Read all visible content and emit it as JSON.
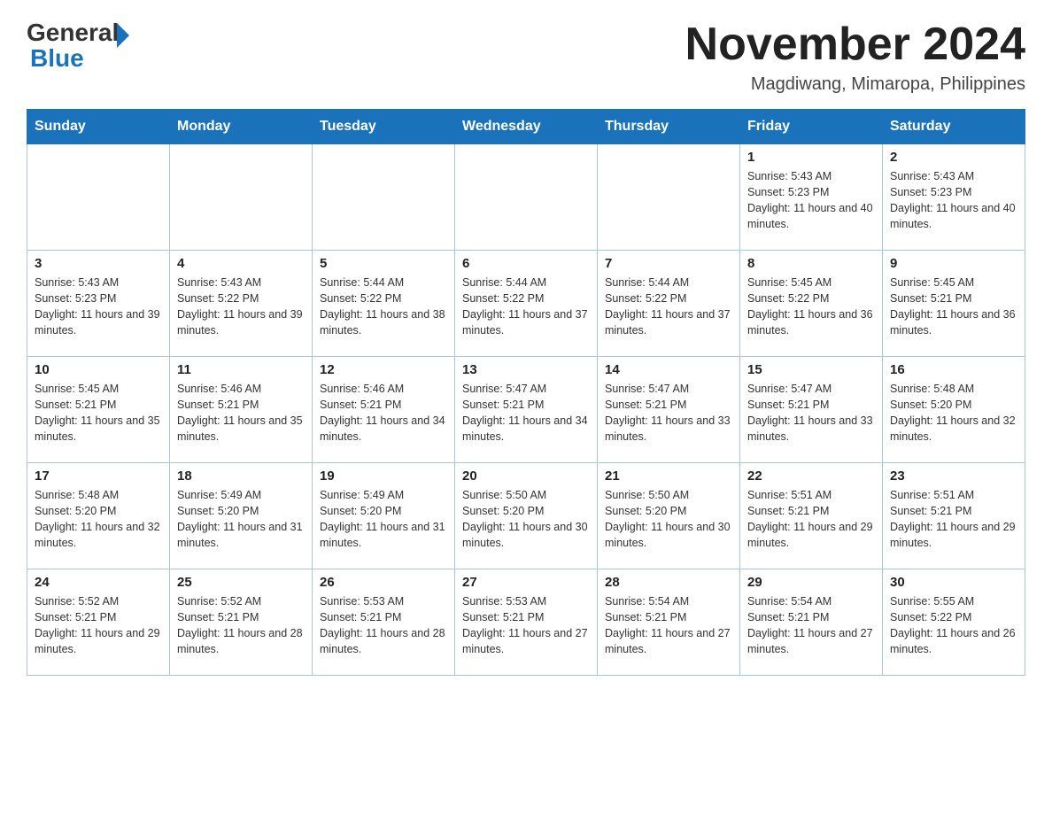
{
  "header": {
    "logo_general": "General",
    "logo_arrow": "",
    "logo_blue": "Blue",
    "main_title": "November 2024",
    "subtitle": "Magdiwang, Mimaropa, Philippines"
  },
  "days_of_week": [
    "Sunday",
    "Monday",
    "Tuesday",
    "Wednesday",
    "Thursday",
    "Friday",
    "Saturday"
  ],
  "weeks": [
    [
      {
        "day": "",
        "info": ""
      },
      {
        "day": "",
        "info": ""
      },
      {
        "day": "",
        "info": ""
      },
      {
        "day": "",
        "info": ""
      },
      {
        "day": "",
        "info": ""
      },
      {
        "day": "1",
        "info": "Sunrise: 5:43 AM\nSunset: 5:23 PM\nDaylight: 11 hours and 40 minutes."
      },
      {
        "day": "2",
        "info": "Sunrise: 5:43 AM\nSunset: 5:23 PM\nDaylight: 11 hours and 40 minutes."
      }
    ],
    [
      {
        "day": "3",
        "info": "Sunrise: 5:43 AM\nSunset: 5:23 PM\nDaylight: 11 hours and 39 minutes."
      },
      {
        "day": "4",
        "info": "Sunrise: 5:43 AM\nSunset: 5:22 PM\nDaylight: 11 hours and 39 minutes."
      },
      {
        "day": "5",
        "info": "Sunrise: 5:44 AM\nSunset: 5:22 PM\nDaylight: 11 hours and 38 minutes."
      },
      {
        "day": "6",
        "info": "Sunrise: 5:44 AM\nSunset: 5:22 PM\nDaylight: 11 hours and 37 minutes."
      },
      {
        "day": "7",
        "info": "Sunrise: 5:44 AM\nSunset: 5:22 PM\nDaylight: 11 hours and 37 minutes."
      },
      {
        "day": "8",
        "info": "Sunrise: 5:45 AM\nSunset: 5:22 PM\nDaylight: 11 hours and 36 minutes."
      },
      {
        "day": "9",
        "info": "Sunrise: 5:45 AM\nSunset: 5:21 PM\nDaylight: 11 hours and 36 minutes."
      }
    ],
    [
      {
        "day": "10",
        "info": "Sunrise: 5:45 AM\nSunset: 5:21 PM\nDaylight: 11 hours and 35 minutes."
      },
      {
        "day": "11",
        "info": "Sunrise: 5:46 AM\nSunset: 5:21 PM\nDaylight: 11 hours and 35 minutes."
      },
      {
        "day": "12",
        "info": "Sunrise: 5:46 AM\nSunset: 5:21 PM\nDaylight: 11 hours and 34 minutes."
      },
      {
        "day": "13",
        "info": "Sunrise: 5:47 AM\nSunset: 5:21 PM\nDaylight: 11 hours and 34 minutes."
      },
      {
        "day": "14",
        "info": "Sunrise: 5:47 AM\nSunset: 5:21 PM\nDaylight: 11 hours and 33 minutes."
      },
      {
        "day": "15",
        "info": "Sunrise: 5:47 AM\nSunset: 5:21 PM\nDaylight: 11 hours and 33 minutes."
      },
      {
        "day": "16",
        "info": "Sunrise: 5:48 AM\nSunset: 5:20 PM\nDaylight: 11 hours and 32 minutes."
      }
    ],
    [
      {
        "day": "17",
        "info": "Sunrise: 5:48 AM\nSunset: 5:20 PM\nDaylight: 11 hours and 32 minutes."
      },
      {
        "day": "18",
        "info": "Sunrise: 5:49 AM\nSunset: 5:20 PM\nDaylight: 11 hours and 31 minutes."
      },
      {
        "day": "19",
        "info": "Sunrise: 5:49 AM\nSunset: 5:20 PM\nDaylight: 11 hours and 31 minutes."
      },
      {
        "day": "20",
        "info": "Sunrise: 5:50 AM\nSunset: 5:20 PM\nDaylight: 11 hours and 30 minutes."
      },
      {
        "day": "21",
        "info": "Sunrise: 5:50 AM\nSunset: 5:20 PM\nDaylight: 11 hours and 30 minutes."
      },
      {
        "day": "22",
        "info": "Sunrise: 5:51 AM\nSunset: 5:21 PM\nDaylight: 11 hours and 29 minutes."
      },
      {
        "day": "23",
        "info": "Sunrise: 5:51 AM\nSunset: 5:21 PM\nDaylight: 11 hours and 29 minutes."
      }
    ],
    [
      {
        "day": "24",
        "info": "Sunrise: 5:52 AM\nSunset: 5:21 PM\nDaylight: 11 hours and 29 minutes."
      },
      {
        "day": "25",
        "info": "Sunrise: 5:52 AM\nSunset: 5:21 PM\nDaylight: 11 hours and 28 minutes."
      },
      {
        "day": "26",
        "info": "Sunrise: 5:53 AM\nSunset: 5:21 PM\nDaylight: 11 hours and 28 minutes."
      },
      {
        "day": "27",
        "info": "Sunrise: 5:53 AM\nSunset: 5:21 PM\nDaylight: 11 hours and 27 minutes."
      },
      {
        "day": "28",
        "info": "Sunrise: 5:54 AM\nSunset: 5:21 PM\nDaylight: 11 hours and 27 minutes."
      },
      {
        "day": "29",
        "info": "Sunrise: 5:54 AM\nSunset: 5:21 PM\nDaylight: 11 hours and 27 minutes."
      },
      {
        "day": "30",
        "info": "Sunrise: 5:55 AM\nSunset: 5:22 PM\nDaylight: 11 hours and 26 minutes."
      }
    ]
  ]
}
